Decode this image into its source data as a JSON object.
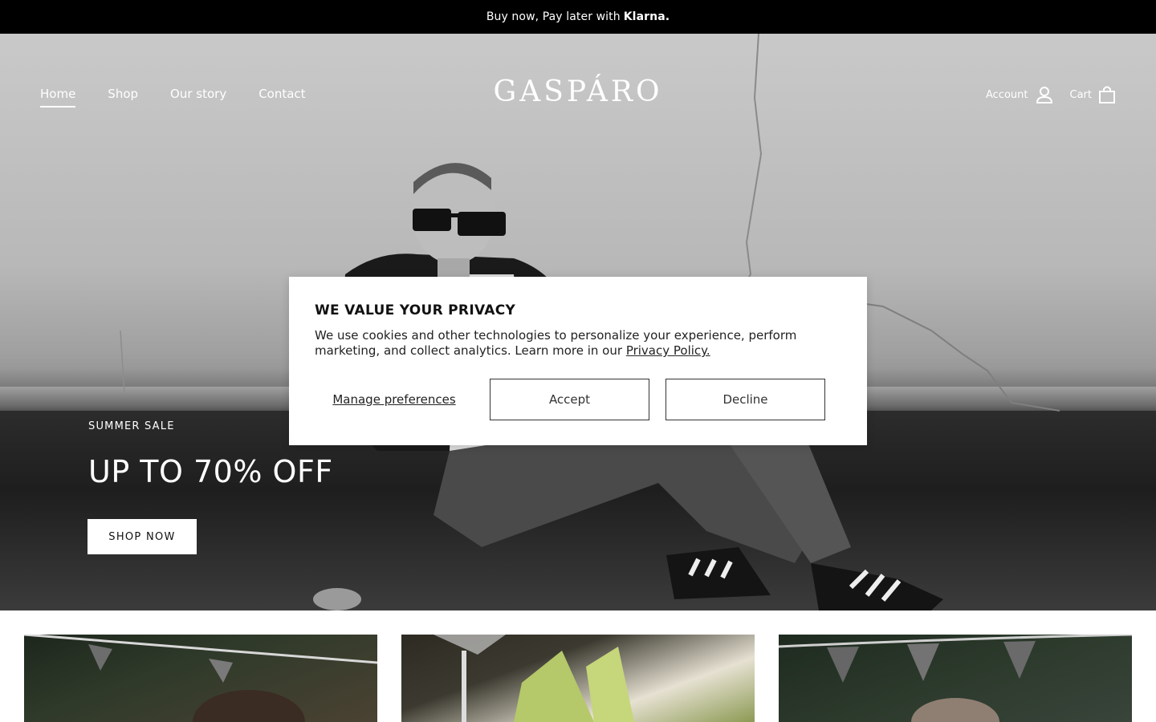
{
  "announcement": {
    "text": "Buy now, Pay later with",
    "brand": "Klarna."
  },
  "header": {
    "logo": "GASPÁRO",
    "nav": [
      {
        "label": "Home",
        "active": true
      },
      {
        "label": "Shop",
        "active": false
      },
      {
        "label": "Our story",
        "active": false
      },
      {
        "label": "Contact",
        "active": false
      }
    ],
    "account_label": "Account",
    "account_icon": "user-icon",
    "cart_label": "Cart",
    "cart_icon": "shopping-bag-icon"
  },
  "hero": {
    "eyebrow": "SUMMER SALE",
    "headline": "UP TO 70% OFF",
    "cta_label": "SHOP NOW"
  },
  "privacy_modal": {
    "title": "WE VALUE YOUR PRIVACY",
    "body": "We use cookies and other technologies to personalize your experience, perform marketing, and collect analytics. Learn more in our",
    "policy_link": "Privacy Policy.",
    "manage_label": "Manage preferences",
    "accept_label": "Accept",
    "decline_label": "Decline"
  },
  "colors": {
    "bar": "#000000",
    "text_light": "#ffffff",
    "modal_bg": "#ffffff"
  }
}
